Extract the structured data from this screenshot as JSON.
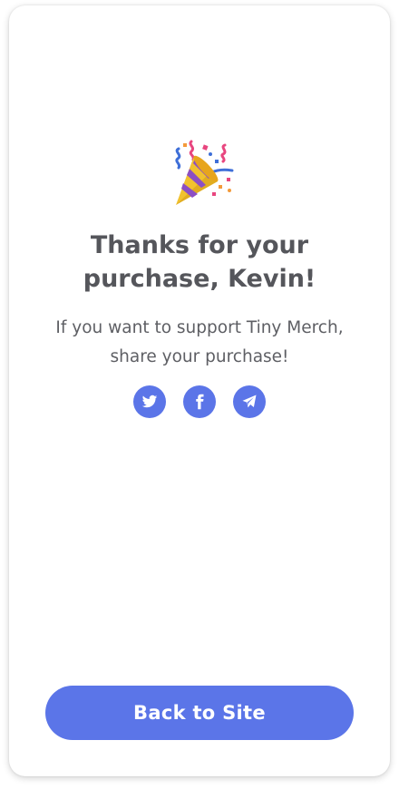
{
  "confirmation": {
    "icon": "party-popper-icon",
    "title_line1": "Thanks for your",
    "title_line2": "purchase, Kevin!",
    "message_line1": "If you want to support Tiny Merch,",
    "message_line2": "share your purchase!"
  },
  "share": {
    "buttons": [
      {
        "icon": "twitter-icon"
      },
      {
        "icon": "facebook-icon"
      },
      {
        "icon": "telegram-icon"
      }
    ]
  },
  "footer": {
    "back_label": "Back to Site"
  },
  "colors": {
    "accent": "#5b75e8",
    "heading": "#55565b",
    "body_text": "#5e5f64",
    "background": "#ffffff"
  }
}
